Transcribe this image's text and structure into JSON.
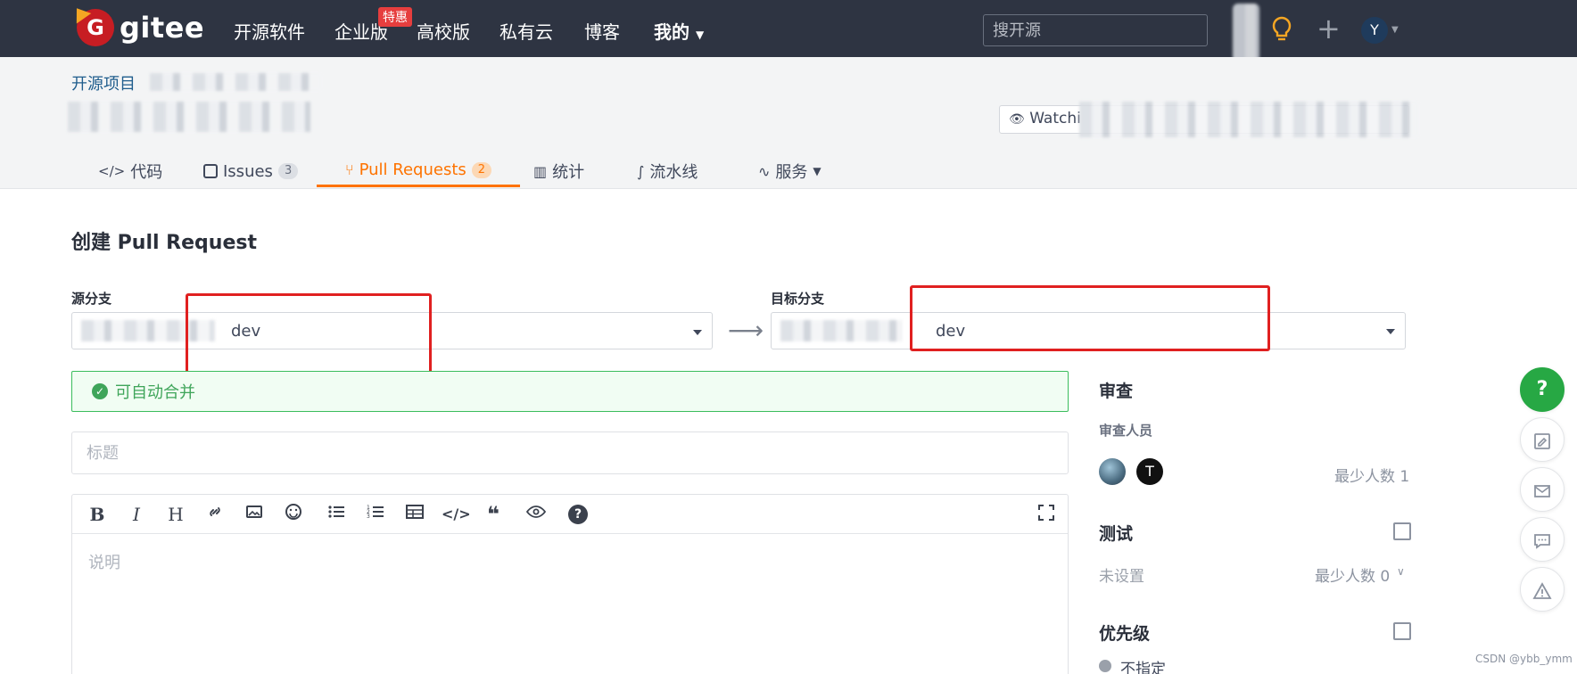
{
  "topbar": {
    "logo_text": "gitee",
    "nav": [
      "开源软件",
      "企业版",
      "高校版",
      "私有云",
      "博客",
      "我的"
    ],
    "enterprise_badge": "特惠",
    "search_placeholder": "搜开源",
    "user_initial": "Y",
    "plus_symbol": "+"
  },
  "header": {
    "breadcrumb": "开源项目",
    "watch_label": "Watchi",
    "tabs": [
      {
        "label": "代码",
        "icon": "code-icon"
      },
      {
        "label": "Issues",
        "count": "3",
        "icon": "issues-icon"
      },
      {
        "label": "Pull Requests",
        "count": "2",
        "icon": "pull-request-icon",
        "active": true
      },
      {
        "label": "统计",
        "icon": "stats-icon"
      },
      {
        "label": "流水线",
        "icon": "pipeline-icon"
      },
      {
        "label": "服务",
        "icon": "service-icon"
      }
    ]
  },
  "main": {
    "page_title": "创建 Pull Request",
    "source_label": "源分支",
    "target_label": "目标分支",
    "source_branch": "dev",
    "target_branch": "dev",
    "merge_status": "可自动合并",
    "title_placeholder": "标题",
    "description_placeholder": "说明",
    "toolbar": {
      "bold": "B",
      "italic": "I",
      "heading": "H",
      "code": "</>",
      "quote": "❝",
      "help": "?"
    }
  },
  "sidebar": {
    "review_title": "审查",
    "reviewers_label": "审查人员",
    "reviewer_initial": "T",
    "review_min": "最少人数 1",
    "test_title": "测试",
    "test_value": "未设置",
    "test_min": "最少人数 0",
    "priority_title": "优先级",
    "priority_value": "不指定"
  },
  "float": {
    "help": "?"
  },
  "watermark": "CSDN @ybb_ymm",
  "colors": {
    "topbar": "#2e3442",
    "accent_orange": "#fe7300",
    "success_green": "#3fa55a",
    "highlight_red": "#e02020"
  }
}
